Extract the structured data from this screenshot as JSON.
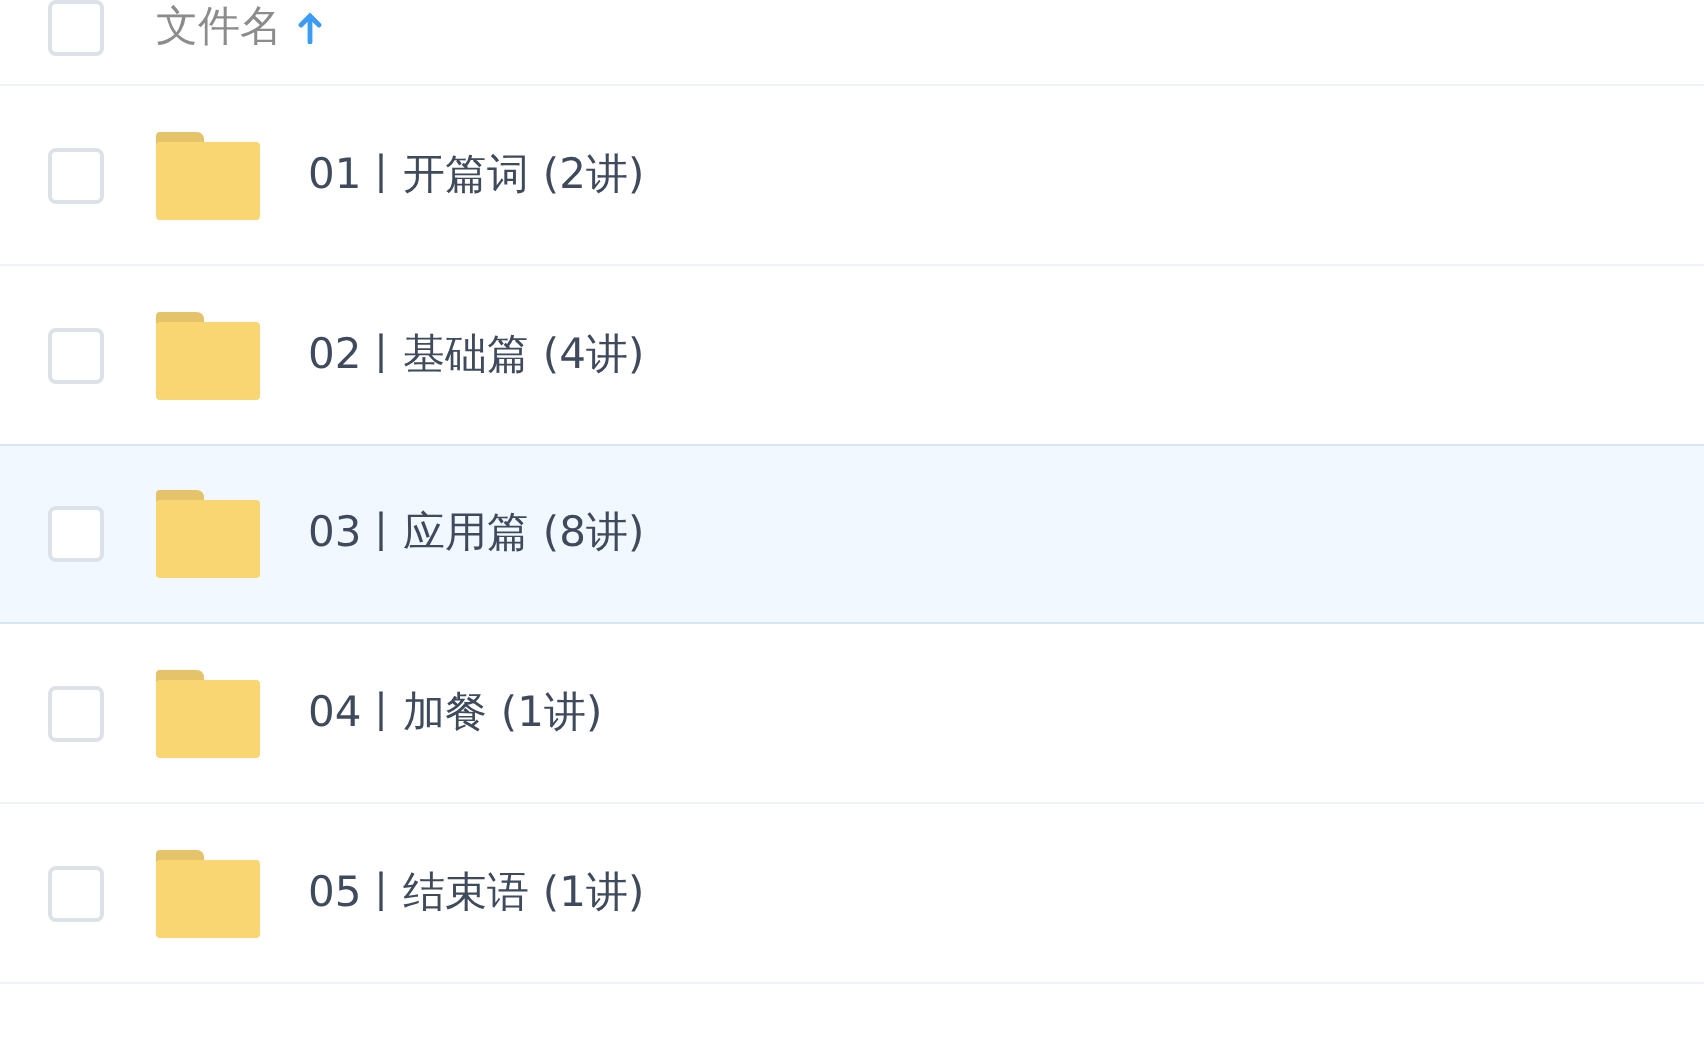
{
  "header": {
    "checked": false,
    "column_label": "文件名",
    "sorted_ascending": true
  },
  "rows": [
    {
      "name": "01丨开篇词 (2讲)",
      "checked": false,
      "highlighted": false
    },
    {
      "name": "02丨基础篇 (4讲)",
      "checked": false,
      "highlighted": false
    },
    {
      "name": "03丨应用篇 (8讲)",
      "checked": false,
      "highlighted": true
    },
    {
      "name": "04丨加餐 (1讲)",
      "checked": false,
      "highlighted": false
    },
    {
      "name": "05丨结束语 (1讲)",
      "checked": false,
      "highlighted": false
    }
  ]
}
